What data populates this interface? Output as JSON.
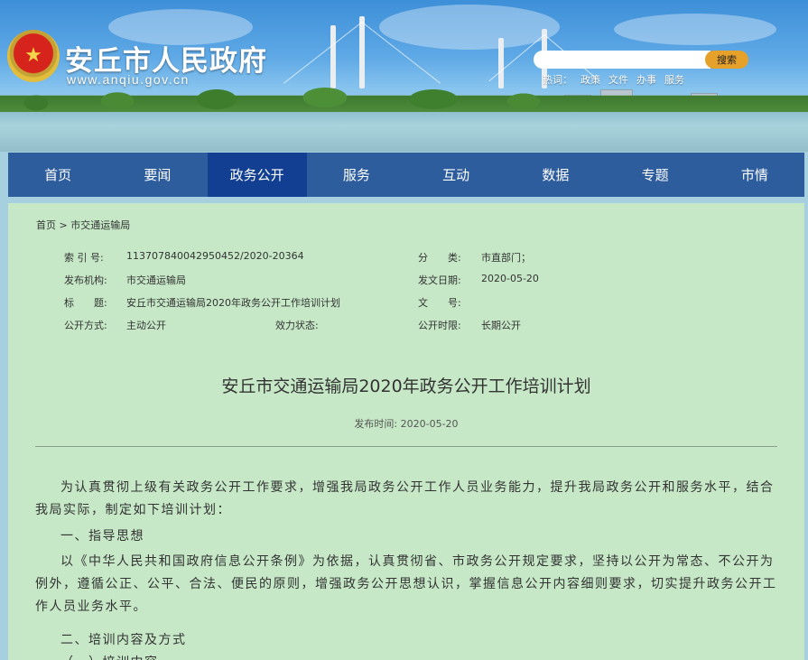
{
  "header": {
    "site_name": "安丘市人民政府",
    "site_url": "www.anqiu.gov.cn",
    "search": {
      "placeholder": "",
      "button_label": "搜索"
    },
    "hot_words": {
      "label": "热词：",
      "items": [
        "政策",
        "文件",
        "办事",
        "服务"
      ]
    }
  },
  "nav": {
    "items": [
      "首页",
      "要闻",
      "政务公开",
      "服务",
      "互动",
      "数据",
      "专题",
      "市情"
    ],
    "active_index": 2
  },
  "breadcrumb": {
    "home": "首页",
    "separator": " > ",
    "current": "市交通运输局"
  },
  "meta": {
    "index_no_label": "索 引 号:",
    "index_no_value": "113707840042950452/2020-20364",
    "category_label": "分　　类:",
    "category_value": "市直部门；",
    "publisher_label": "发布机构:",
    "publisher_value": "市交通运输局",
    "issue_date_label": "发文日期:",
    "issue_date_value": "2020-05-20",
    "title_label": "标　　题:",
    "title_value": "安丘市交通运输局2020年政务公开工作培训计划",
    "doc_no_label": "文　　号:",
    "doc_no_value": "",
    "open_mode_label": "公开方式:",
    "open_mode_value": "主动公开",
    "validity_label": "效力状态:",
    "validity_value": "",
    "open_period_label": "公开时限:",
    "open_period_value": "长期公开"
  },
  "article": {
    "title": "安丘市交通运输局2020年政务公开工作培训计划",
    "pub_time": "发布时间: 2020-05-20",
    "p1": "为认真贯彻上级有关政务公开工作要求，增强我局政务公开工作人员业务能力，提升我局政务公开和服务水平，结合我局实际，制定如下培训计划：",
    "h1": "一、指导思想",
    "p2": "以《中华人民共和国政府信息公开条例》为依据，认真贯彻省、市政务公开规定要求，坚持以公开为常态、不公开为例外，遵循公正、公平、合法、便民的原则，增强政务公开思想认识，掌握信息公开内容细则要求，切实提升政务公开工作人员业务水平。",
    "h2": "二、培训内容及方式",
    "h3": "（一）培训内容"
  }
}
